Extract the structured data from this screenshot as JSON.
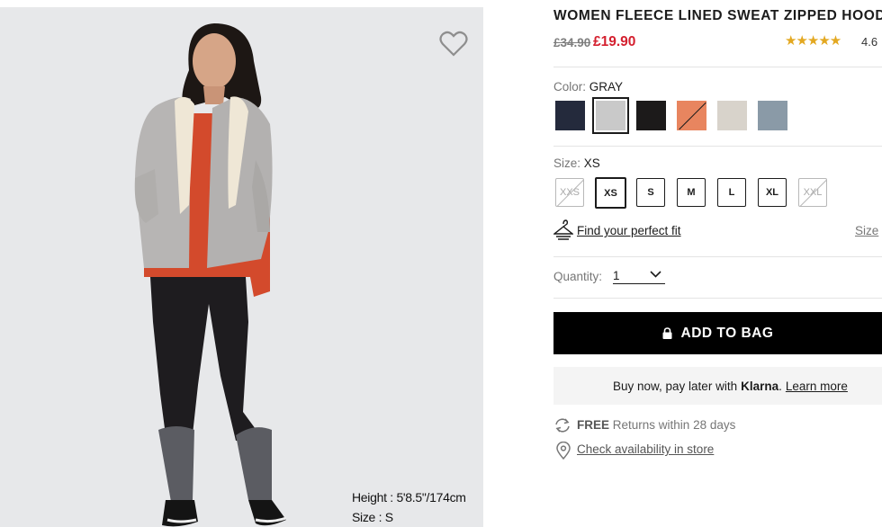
{
  "product": {
    "title": "WOMEN FLEECE LINED SWEAT ZIPPED HOODIE",
    "price_old": "£34.90",
    "price_new": "£19.90",
    "stars": "★★★★★",
    "rating_value": 4.6,
    "rating": "4.6"
  },
  "image": {
    "model_height": "Height : 5'8.5\"/174cm",
    "model_size": "Size : S"
  },
  "color": {
    "label": "Color:",
    "selected": "GRAY",
    "swatches": [
      {
        "name": "navy",
        "hex": "#242a3c",
        "available": true
      },
      {
        "name": "gray",
        "hex": "#c9c9c9",
        "available": true,
        "selected": true
      },
      {
        "name": "black",
        "hex": "#1c1a1a",
        "available": true
      },
      {
        "name": "orange",
        "hex": "#e8855f",
        "available": false
      },
      {
        "name": "beige",
        "hex": "#d8d3cb",
        "available": true
      },
      {
        "name": "blue-gray",
        "hex": "#8a9aa7",
        "available": true
      }
    ]
  },
  "size": {
    "label": "Size:",
    "selected": "XS",
    "options": [
      {
        "label": "XXS",
        "available": false
      },
      {
        "label": "XS",
        "available": true,
        "selected": true
      },
      {
        "label": "S",
        "available": true
      },
      {
        "label": "M",
        "available": true
      },
      {
        "label": "L",
        "available": true
      },
      {
        "label": "XL",
        "available": true
      },
      {
        "label": "XXL",
        "available": false
      }
    ],
    "fit_link": "Find your perfect fit",
    "guide_link": "Size"
  },
  "quantity": {
    "label": "Quantity:",
    "value": "1"
  },
  "cta": {
    "add_to_bag": "ADD TO BAG"
  },
  "klarna": {
    "prefix": "Buy now, pay later with",
    "brand": "Klarna",
    "learn_more": "Learn more"
  },
  "returns": {
    "free": "FREE",
    "text": "Returns within 28 days"
  },
  "store": {
    "link": "Check availability in store"
  },
  "colors": {
    "sale_red": "#d41f2e",
    "star_gold": "#e3a821",
    "background_gray": "#e7e8ea"
  },
  "icons": [
    "heart-icon",
    "hanger-icon",
    "chevron-down-icon",
    "lock-icon",
    "refresh-icon",
    "location-pin-icon"
  ]
}
